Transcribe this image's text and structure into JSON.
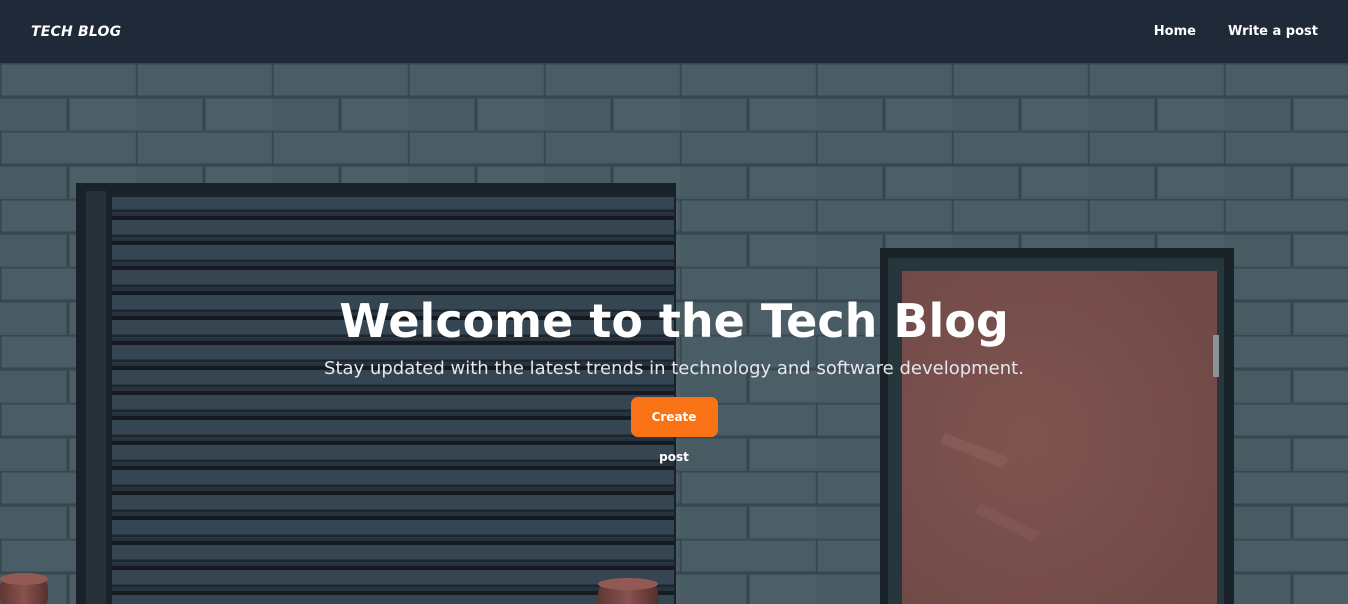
{
  "navbar": {
    "brand": "TECH BLOG",
    "links": [
      {
        "label": "Home"
      },
      {
        "label": "Write a post"
      }
    ]
  },
  "hero": {
    "title": "Welcome to the Tech Blog",
    "subtitle": "Stay updated with the latest trends in technology and software development.",
    "cta_label": "Create post",
    "background_image": "concrete-block-wall-with-garage-roll-up-door-and-red-door"
  },
  "colors": {
    "navbar_bg": "#1f2937",
    "accent": "#f97316",
    "wall": "#4d5f69",
    "garage_door": "#3a4a57",
    "red_door": "#8c5a55"
  }
}
